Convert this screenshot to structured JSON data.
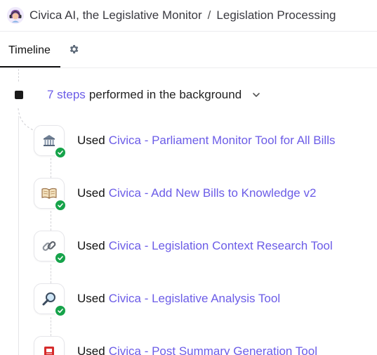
{
  "header": {
    "app_name": "Civica AI, the Legislative Monitor",
    "separator": "/",
    "page": "Legislation Processing"
  },
  "tabs": [
    {
      "label": "Timeline",
      "active": true
    }
  ],
  "timeline": {
    "steps_count": "7 steps",
    "steps_suffix": "performed in the background",
    "steps": [
      {
        "used_label": "Used",
        "tool": "Civica - Parliament Monitor Tool for All Bills",
        "icon": "classical-building-icon",
        "status": "completed"
      },
      {
        "used_label": "Used",
        "tool": "Civica - Add New Bills to Knowledge v2",
        "icon": "open-book-icon",
        "status": "completed"
      },
      {
        "used_label": "Used",
        "tool": "Civica - Legislation Context Research Tool",
        "icon": "link-icon",
        "status": "completed"
      },
      {
        "used_label": "Used",
        "tool": "Civica - Legislative Analysis Tool",
        "icon": "magnifier-icon",
        "status": "completed"
      },
      {
        "used_label": "Used",
        "tool": "Civica - Post Summary Generation Tool",
        "icon": "red-page-icon",
        "status": "completed"
      }
    ]
  },
  "colors": {
    "accent": "#6b5ce7",
    "success": "#16a34a",
    "text": "#111111"
  }
}
